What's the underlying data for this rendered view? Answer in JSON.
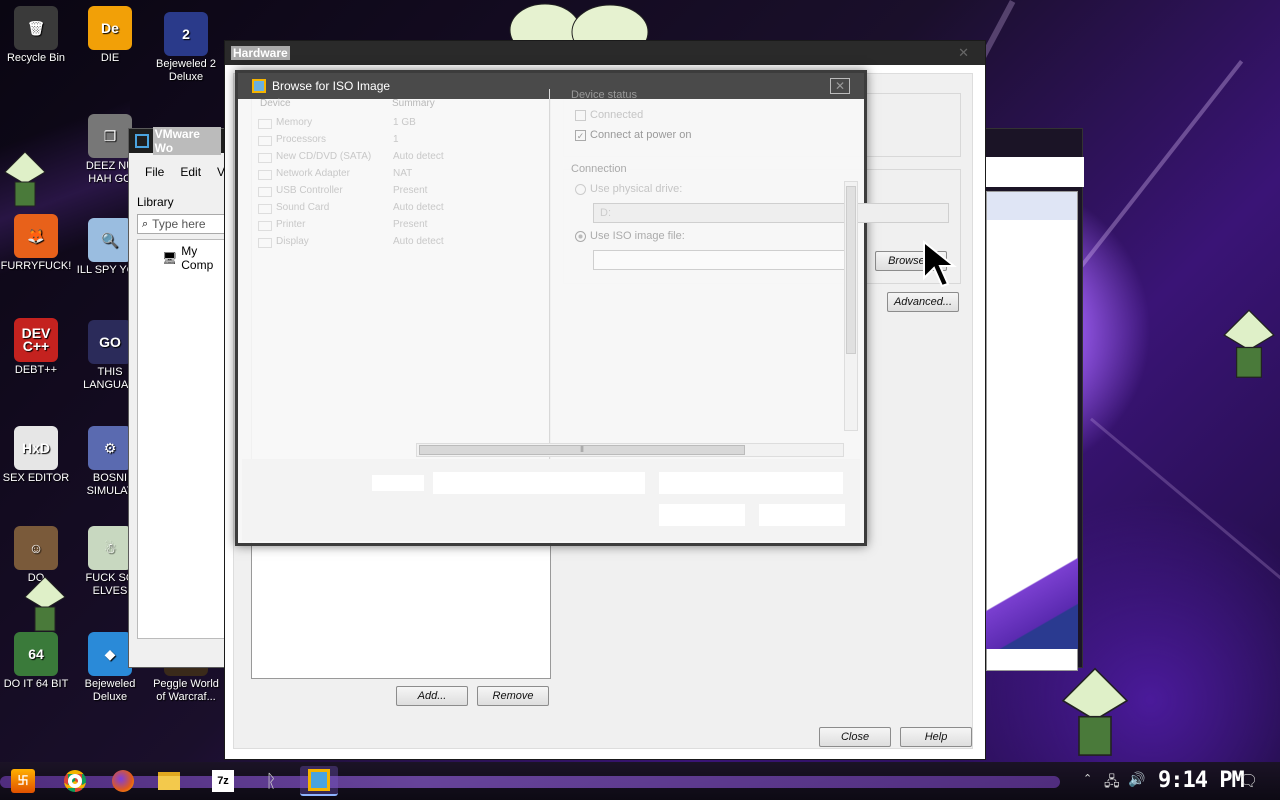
{
  "desktop_icons": [
    {
      "label": "Recycle Bin",
      "color": "#3a3a3a",
      "glyph": "🗑"
    },
    {
      "label": "DIE",
      "color": "#f2a007",
      "glyph": "De"
    },
    {
      "label": "Bejeweled 2 Deluxe",
      "color": "#2a3a8a",
      "glyph": "2"
    },
    {
      "label": "DEEZ NU HAH GO",
      "color": "#777777",
      "glyph": "❐"
    },
    {
      "label": "FURRYFUCK!",
      "color": "#e8611a",
      "glyph": "🦊"
    },
    {
      "label": "ILL SPY YOU",
      "color": "#9abde0",
      "glyph": "🔍"
    },
    {
      "label": "DEBT++",
      "color": "#c4221f",
      "glyph": "DEV C++"
    },
    {
      "label": "THIS LANGUAG",
      "color": "#2b2b5a",
      "glyph": "GO"
    },
    {
      "label": "SEX EDITOR",
      "color": "#e6e6e6",
      "glyph": "HxD"
    },
    {
      "label": "BOSNI SIMULAT",
      "color": "#5a6ab0",
      "glyph": "⚙"
    },
    {
      "label": "DO",
      "color": "#7a5a3a",
      "glyph": "☺"
    },
    {
      "label": "FUCK SO ELVES",
      "color": "#c8d8c0",
      "glyph": "☃"
    },
    {
      "label": "DO IT 64 BIT",
      "color": "#3a7a3a",
      "glyph": "64"
    },
    {
      "label": "Bejeweled Deluxe",
      "color": "#2a8ad8",
      "glyph": "◆"
    },
    {
      "label": "Peggle World of Warcraf...",
      "color": "#3a2a1a",
      "glyph": "P"
    }
  ],
  "vmware_main": {
    "title": "VMware Wo",
    "menu": [
      "File",
      "Edit",
      "Vie"
    ],
    "library_label": "Library",
    "search_placeholder": "Type here",
    "tree_item": "My Comp"
  },
  "hardware_dialog": {
    "title": "Hardware",
    "add_button": "Add...",
    "remove_button": "Remove",
    "close_button": "Close",
    "help_button": "Help",
    "advanced_button": "Advanced...",
    "browse_button": "Browse...",
    "device_status": {
      "label": "Device status",
      "connected": "Connected",
      "connect_at_power_on": "Connect at power on"
    },
    "connection": {
      "label": "Connection",
      "use_physical_drive": "Use physical drive:",
      "drive_value": "D:",
      "use_iso_image": "Use ISO image file:"
    },
    "device_header": "Device",
    "summary_header": "Summary",
    "devices": [
      {
        "name": "Memory",
        "summary": "1 GB"
      },
      {
        "name": "Processors",
        "summary": "1"
      },
      {
        "name": "New CD/DVD (SATA)",
        "summary": "Auto detect"
      },
      {
        "name": "Network Adapter",
        "summary": "NAT"
      },
      {
        "name": "USB Controller",
        "summary": "Present"
      },
      {
        "name": "Sound Card",
        "summary": "Auto detect"
      },
      {
        "name": "Printer",
        "summary": "Present"
      },
      {
        "name": "Display",
        "summary": "Auto detect"
      }
    ]
  },
  "browse_dialog": {
    "title": "Browse for ISO Image"
  },
  "taskbar": {
    "clock": "9:14 PM",
    "apps": [
      "start",
      "chrome",
      "firefox",
      "file-explorer",
      "7zip",
      "unknown-app",
      "vmware"
    ]
  }
}
